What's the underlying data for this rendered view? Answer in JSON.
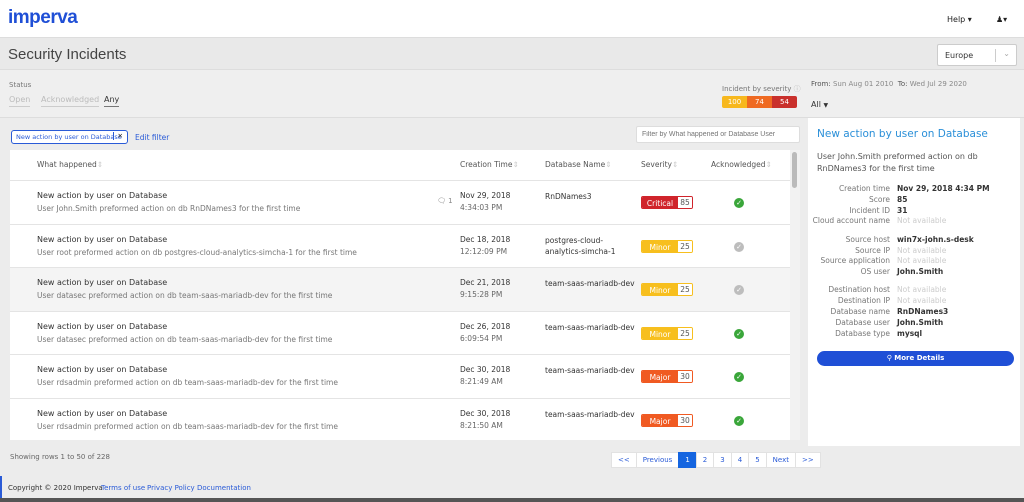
{
  "header": {
    "logo": "imperva",
    "help": "Help ▾",
    "user_menu": "▾"
  },
  "page": {
    "title": "Security Incidents",
    "region": "Europe"
  },
  "filters": {
    "status_label": "Status",
    "tabs": [
      "Open",
      "Acknowledged",
      "Any"
    ],
    "active_tab": "Any",
    "severity_label": "Incident by severity",
    "severity_counts": [
      {
        "value": "100",
        "color": "#f7b81e"
      },
      {
        "value": "74",
        "color": "#ef6a22"
      },
      {
        "value": "54",
        "color": "#c9302c"
      }
    ],
    "from_label": "From:",
    "from": "Sun Aug 01 2010",
    "to_label": "To:",
    "to": "Wed Jul 29 2020",
    "range_select": "All"
  },
  "filter_chip": "New action by user on Database",
  "chip_close": "✕",
  "edit_filter": "Edit filter",
  "search_placeholder": "Filter by What happened or Database User",
  "table": {
    "columns": [
      "What happened",
      "Creation Time",
      "Database Name",
      "Severity",
      "Acknowledged"
    ],
    "rows": [
      {
        "title": "New action by user on Database",
        "desc": "User John.Smith preformed action on db RnDNames3 for the first time",
        "comments": "1",
        "date": "Nov 29, 2018",
        "time": "4:34:03 PM",
        "db": "RnDNames3",
        "severity": "Critical",
        "score": "85",
        "sev_color": "#d0242b",
        "acknowledged": true
      },
      {
        "title": "New action by user on Database",
        "desc": "User root preformed action on db postgres-cloud-analytics-simcha-1 for the first time",
        "date": "Dec 18, 2018",
        "time": "12:12:09 PM",
        "db": "postgres-cloud-analytics-simcha-1",
        "severity": "Minor",
        "score": "25",
        "sev_color": "#f7bf1e",
        "acknowledged": false
      },
      {
        "title": "New action by user on Database",
        "desc": "User datasec preformed action on db team-saas-mariadb-dev for the first time",
        "date": "Dec 21, 2018",
        "time": "9:15:28 PM",
        "db": "team-saas-mariadb-dev",
        "severity": "Minor",
        "score": "25",
        "sev_color": "#f7bf1e",
        "acknowledged": false
      },
      {
        "title": "New action by user on Database",
        "desc": "User datasec preformed action on db team-saas-mariadb-dev for the first time",
        "date": "Dec 26, 2018",
        "time": "6:09:54 PM",
        "db": "team-saas-mariadb-dev",
        "severity": "Minor",
        "score": "25",
        "sev_color": "#f7bf1e",
        "acknowledged": true
      },
      {
        "title": "New action by user on Database",
        "desc": "User rdsadmin preformed action on db team-saas-mariadb-dev for the first time",
        "date": "Dec 30, 2018",
        "time": "8:21:49 AM",
        "db": "team-saas-mariadb-dev",
        "severity": "Major",
        "score": "30",
        "sev_color": "#f05a22",
        "acknowledged": true
      },
      {
        "title": "New action by user on Database",
        "desc": "User rdsadmin preformed action on db team-saas-mariadb-dev for the first time",
        "date": "Dec 30, 2018",
        "time": "8:21:50 AM",
        "db": "team-saas-mariadb-dev",
        "severity": "Major",
        "score": "30",
        "sev_color": "#f05a22",
        "acknowledged": true
      }
    ]
  },
  "pagination": {
    "info": "Showing rows 1 to 50 of 228",
    "buttons": [
      "<<",
      "Previous",
      "1",
      "2",
      "3",
      "4",
      "5",
      "Next",
      ">>"
    ],
    "current": "1"
  },
  "details": {
    "title": "New action by user on Database",
    "desc": "User John.Smith preformed action on db RnDNames3 for the first time",
    "groups": [
      [
        [
          "Creation time",
          "Nov 29, 2018 4:34 PM"
        ],
        [
          "Score",
          "85"
        ],
        [
          "Incident ID",
          "31"
        ],
        [
          "Cloud account name",
          "Not available"
        ]
      ],
      [
        [
          "Source host",
          "win7x-john.s-desk"
        ],
        [
          "Source IP",
          "Not available"
        ],
        [
          "Source application",
          "Not available"
        ],
        [
          "OS user",
          "John.Smith"
        ]
      ],
      [
        [
          "Destination host",
          "Not available"
        ],
        [
          "Destination IP",
          "Not available"
        ],
        [
          "Database name",
          "RnDNames3"
        ],
        [
          "Database user",
          "John.Smith"
        ],
        [
          "Database type",
          "mysql"
        ]
      ]
    ],
    "more_button": "More Details"
  },
  "footer": {
    "copyright": "Copyright © 2020 Imperva",
    "links": [
      "Terms of use",
      "Privacy Policy",
      "Documentation"
    ]
  },
  "colors": {
    "brand": "#1f4fd6",
    "ack_yes": "#3aa63a",
    "ack_no": "#bdbdbd"
  }
}
